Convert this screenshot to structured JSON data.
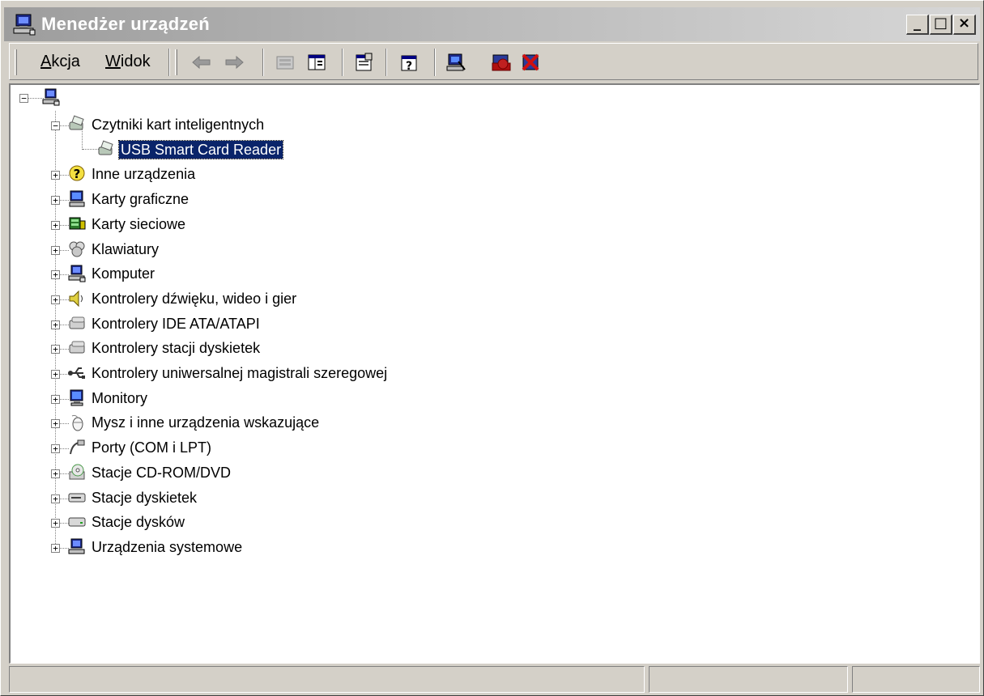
{
  "window": {
    "title": "Menedżer urządzeń",
    "icon": "device-manager-computer-icon",
    "controls": {
      "minimize": "_",
      "maximize": "□",
      "close": "×"
    }
  },
  "menu": {
    "action": {
      "underlined": "A",
      "rest": "kcja"
    },
    "view": {
      "underlined": "W",
      "rest": "idok"
    }
  },
  "toolbar": {
    "buttons": [
      "back-arrow-icon",
      "forward-arrow-icon",
      "up-folder-icon",
      "show-hide-tree-icon",
      "properties-icon",
      "help-icon",
      "scan-hardware-icon",
      "disable-device-icon",
      "uninstall-device-icon"
    ]
  },
  "tree": {
    "root_icon": "computer-icon",
    "nodes": [
      {
        "label": "Czytniki kart inteligentnych",
        "icon": "smart-card-reader-icon",
        "expanded": true
      },
      {
        "label": "USB Smart Card Reader",
        "icon": "smart-card-reader-icon",
        "child": true,
        "selected": true
      },
      {
        "label": "Inne urządzenia",
        "icon": "question-mark-icon"
      },
      {
        "label": "Karty graficzne",
        "icon": "display-adapter-icon"
      },
      {
        "label": "Karty sieciowe",
        "icon": "network-card-icon"
      },
      {
        "label": "Klawiatury",
        "icon": "keyboard-icon"
      },
      {
        "label": "Komputer",
        "icon": "computer-icon"
      },
      {
        "label": "Kontrolery dźwięku, wideo i gier",
        "icon": "speaker-icon"
      },
      {
        "label": "Kontrolery IDE ATA/ATAPI",
        "icon": "ide-controller-icon"
      },
      {
        "label": "Kontrolery stacji dyskietek",
        "icon": "floppy-controller-icon"
      },
      {
        "label": "Kontrolery uniwersalnej magistrali szeregowej",
        "icon": "usb-icon"
      },
      {
        "label": "Monitory",
        "icon": "monitor-icon"
      },
      {
        "label": "Mysz i inne urządzenia wskazujące",
        "icon": "mouse-icon"
      },
      {
        "label": "Porty (COM i LPT)",
        "icon": "port-icon"
      },
      {
        "label": "Stacje CD-ROM/DVD",
        "icon": "cdrom-icon"
      },
      {
        "label": "Stacje dyskietek",
        "icon": "floppy-drive-icon"
      },
      {
        "label": "Stacje dysków",
        "icon": "disk-drive-icon"
      },
      {
        "label": "Urządzenia systemowe",
        "icon": "system-devices-icon"
      }
    ]
  },
  "statusbar": {
    "cells": [
      "",
      "",
      ""
    ]
  },
  "colors": {
    "selection": "#0a246a",
    "titlebar_start": "#9d9d9d",
    "titlebar_end": "#d7d7d7",
    "face": "#d4d0c8"
  }
}
